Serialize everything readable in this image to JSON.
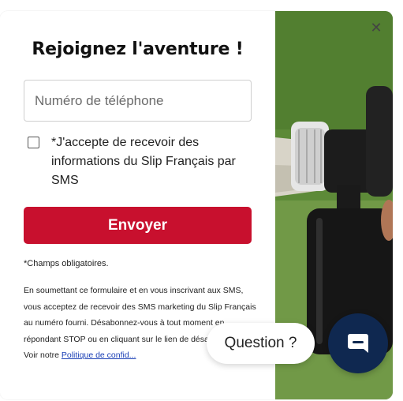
{
  "popup": {
    "title": "Rejoignez l'aventure !",
    "phone_placeholder": "Numéro de téléphone",
    "consent_text": "*J'accepte de recevoir des informations du Slip Français par SMS",
    "submit_label": "Envoyer",
    "required_note": "*Champs obligatoires.",
    "legal_text": "En soumettant ce formulaire et en vous inscrivant aux SMS, vous acceptez de recevoir des SMS marketing du Slip Français au numéro fourni. Désabonnez-vous à tout moment en répondant STOP ou en cliquant sur le lien de désabonnement. Voir notre",
    "policy_link": "Politique de confid...",
    "close_icon": "close-icon",
    "checkbox_checked": false
  },
  "chat": {
    "question_label": "Question ?",
    "chat_icon": "chat-bubble-icon"
  },
  "colors": {
    "brand_red": "#c8102e",
    "chat_navy": "#0f2850",
    "link_blue": "#1a3fb5"
  }
}
